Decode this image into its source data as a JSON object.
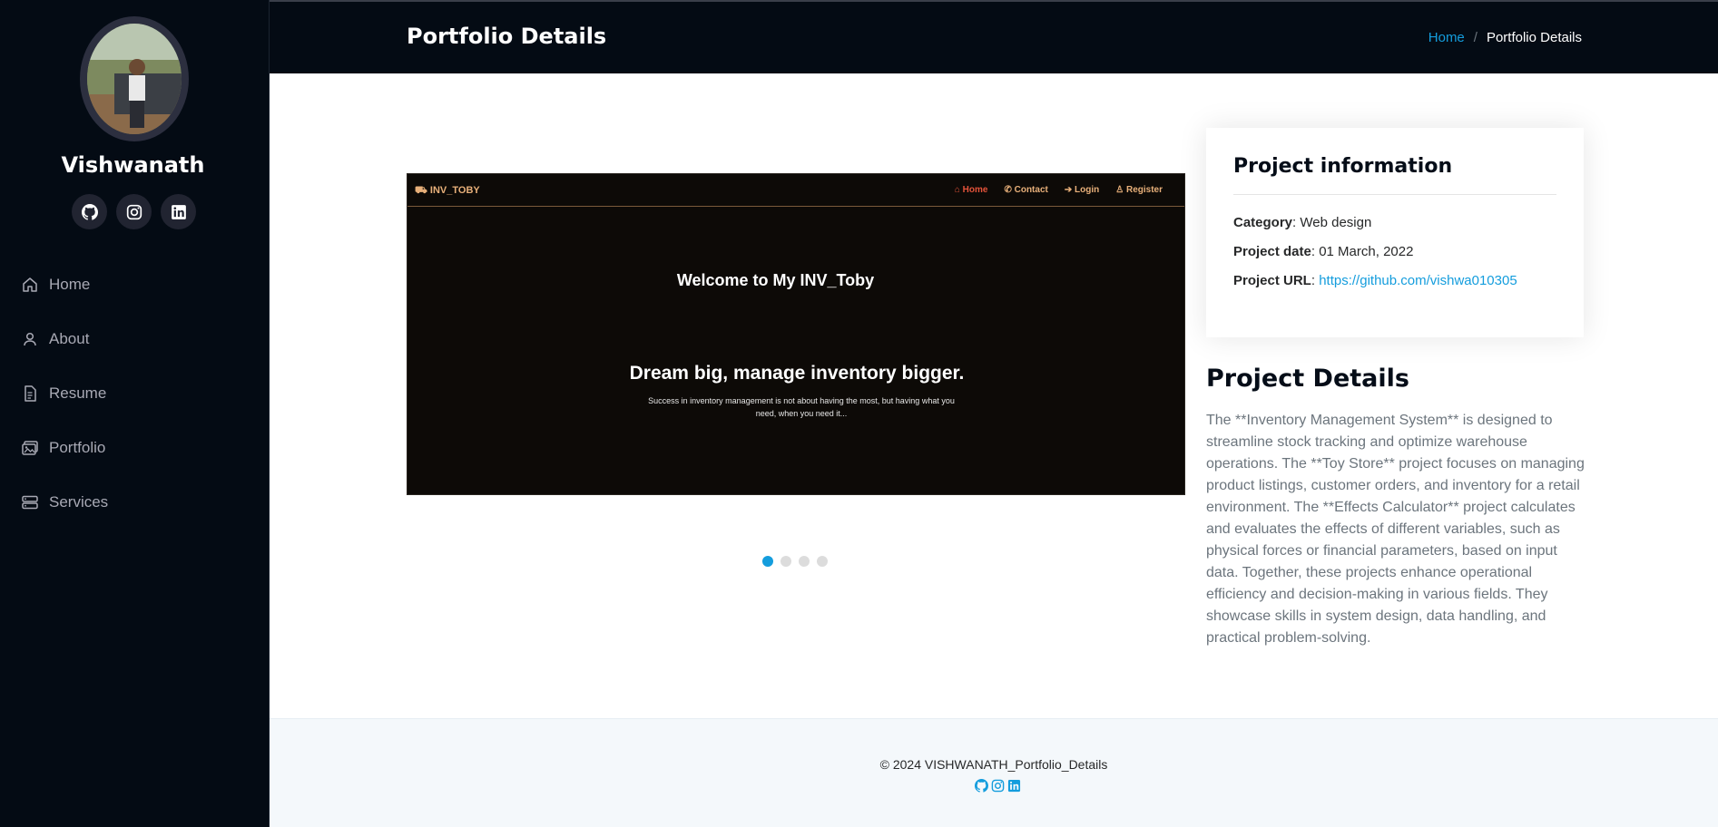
{
  "profile": {
    "name": "Vishwanath"
  },
  "social_icons": [
    "github-icon",
    "instagram-icon",
    "linkedin-icon"
  ],
  "nav": {
    "items": [
      {
        "label": "Home",
        "icon": "home-icon"
      },
      {
        "label": "About",
        "icon": "person-icon"
      },
      {
        "label": "Resume",
        "icon": "file-text-icon"
      },
      {
        "label": "Portfolio",
        "icon": "images-icon"
      },
      {
        "label": "Services",
        "icon": "server-icon"
      }
    ]
  },
  "header": {
    "title": "Portfolio Details",
    "breadcrumb": {
      "home": "Home",
      "separator": "/",
      "current": "Portfolio Details"
    }
  },
  "slide": {
    "brand": "INV_TOBY",
    "links": [
      "Home",
      "Contact",
      "Login",
      "Register"
    ],
    "welcome": "Welcome to My INV_Toby",
    "headline": "Dream big, manage inventory bigger.",
    "tagline": "Success in inventory management is not about having the most, but having what you need, when you need it..."
  },
  "slider": {
    "count": 4,
    "active_index": 0
  },
  "project_info": {
    "title": "Project information",
    "category_label": "Category",
    "category_value": ": Web design",
    "date_label": "Project date",
    "date_value": ": 01 March, 2022",
    "url_label": "Project URL",
    "url_sep": ": ",
    "url_value": "https://github.com/vishwa010305"
  },
  "project_details": {
    "title": "Project Details",
    "text": "The **Inventory Management System** is designed to streamline stock tracking and optimize warehouse operations. The **Toy Store** project focuses on managing product listings, customer orders, and inventory for a retail environment. The **Effects Calculator** project calculates and evaluates the effects of different variables, such as physical forces or financial parameters, based on input data. Together, these projects enhance operational efficiency and decision-making in various fields. They showcase skills in system design, data handling, and practical problem-solving."
  },
  "footer": {
    "copyright": "© 2024   VISHWANATH_Portfolio_Details"
  },
  "colors": {
    "sidebar_bg": "#040b14",
    "accent": "#149ddd",
    "text_muted": "#6c757d"
  }
}
